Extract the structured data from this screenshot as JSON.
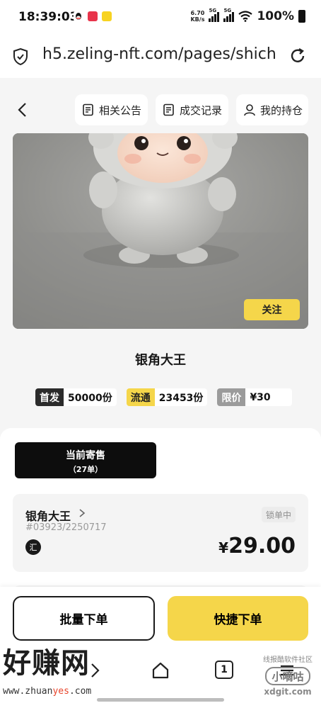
{
  "status_bar": {
    "time": "18:39:03",
    "app_icons": [
      "qq-icon",
      "weibo-icon",
      "meituan-icon"
    ],
    "speed_value": "6.70",
    "speed_unit": "KB/s",
    "signal_1": "5G",
    "signal_2": "5G",
    "battery": "100%"
  },
  "browser": {
    "url": "h5.zeling-nft.com/pages/shich",
    "tab_count": "1"
  },
  "top_nav": {
    "announcements_label": "相关公告",
    "records_label": "成交记录",
    "holdings_label": "我的持仓"
  },
  "hero": {
    "follow_label": "关注"
  },
  "item": {
    "title": "银角大王",
    "tags": [
      {
        "key": "首发",
        "value": "50000份",
        "color": "#2b2b2b"
      },
      {
        "key": "流通",
        "value": "23453份",
        "color": "#f5d64a"
      },
      {
        "key": "限价",
        "value": "¥30",
        "color": "#9b9b9b"
      }
    ]
  },
  "consign": {
    "title": "当前寄售",
    "count": "（27单）"
  },
  "listing": {
    "name": "银角大王",
    "serial": "#03923/2250717",
    "badge": "汇",
    "status": "锁单中",
    "currency": "¥",
    "price": "29.00"
  },
  "actions": {
    "batch_label": "批量下单",
    "quick_label": "快捷下单"
  },
  "watermarks": {
    "left_brand": "好赚网",
    "left_url_a": "www.zhuan",
    "left_url_b": "yes",
    "left_url_c": ".com",
    "right_top": "线报酷软件社区",
    "right_mid": "小嘀咕",
    "right_bottom": "xdgit.com"
  },
  "colors": {
    "accent_yellow": "#f5d64a",
    "dark": "#0d0d0d"
  }
}
